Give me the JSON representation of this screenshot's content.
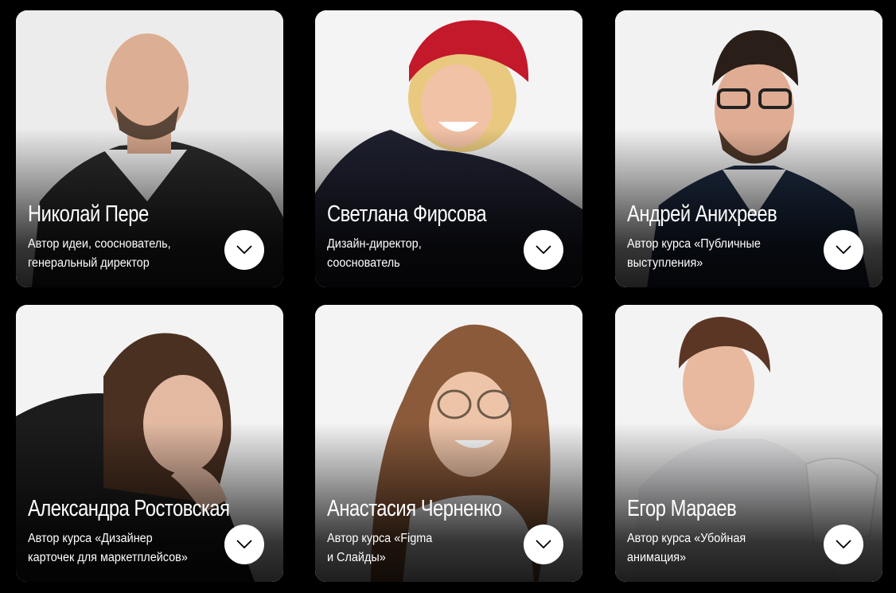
{
  "team": [
    {
      "name": "Николай Пере",
      "role_line1": "Автор идеи, сооснователь,",
      "role_line2": "генеральный директор",
      "icon": "chevron-down-icon"
    },
    {
      "name": "Светлана Фирсова",
      "role_line1": "Дизайн-директор,",
      "role_line2": "сооснователь",
      "icon": "chevron-down-icon"
    },
    {
      "name": "Андрей Анихреев",
      "role_line1": "Автор курса «Публичные",
      "role_line2": "выступления»",
      "icon": "chevron-down-icon"
    },
    {
      "name": "Александра Ростовская",
      "role_line1": "Автор курса «Дизайнер",
      "role_line2": "карточек для маркетплейсов»",
      "icon": "chevron-down-icon"
    },
    {
      "name": "Анастасия Черненко",
      "role_line1": "Автор курса «Figma",
      "role_line2": "и Слайды»",
      "icon": "chevron-down-icon"
    },
    {
      "name": "Егор Мараев",
      "role_line1": "Автор курса «Убойная",
      "role_line2": "анимация»",
      "icon": "chevron-down-icon"
    }
  ],
  "colors": {
    "page_background": "#000000",
    "card_background": "#f2f2f2",
    "text": "#ffffff",
    "button": "#ffffff",
    "chevron": "#000000"
  }
}
